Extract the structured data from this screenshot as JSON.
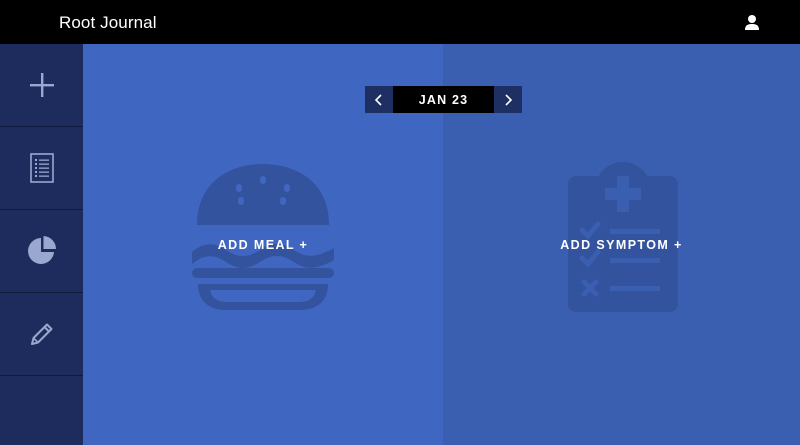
{
  "header": {
    "app_title": "Root Journal",
    "user_icon": "user-icon"
  },
  "sidebar": {
    "items": [
      {
        "name": "add",
        "icon": "plus-icon"
      },
      {
        "name": "journal-list",
        "icon": "list-icon"
      },
      {
        "name": "reports",
        "icon": "pie-chart-icon"
      },
      {
        "name": "edit",
        "icon": "pencil-icon"
      }
    ]
  },
  "date_nav": {
    "label": "JAN 23",
    "prev_icon": "chevron-left-icon",
    "next_icon": "chevron-right-icon"
  },
  "panels": {
    "meal": {
      "label": "ADD MEAL +",
      "icon": "burger-icon"
    },
    "symptom": {
      "label": "ADD SYMPTOM +",
      "icon": "clipboard-medical-icon"
    }
  },
  "colors": {
    "topbar": "#000000",
    "sidebar": "#1d2c5c",
    "meal_panel": "#3f66c1",
    "symptom_panel": "#3a5eb0",
    "icon_on_panel": "#34539e"
  }
}
